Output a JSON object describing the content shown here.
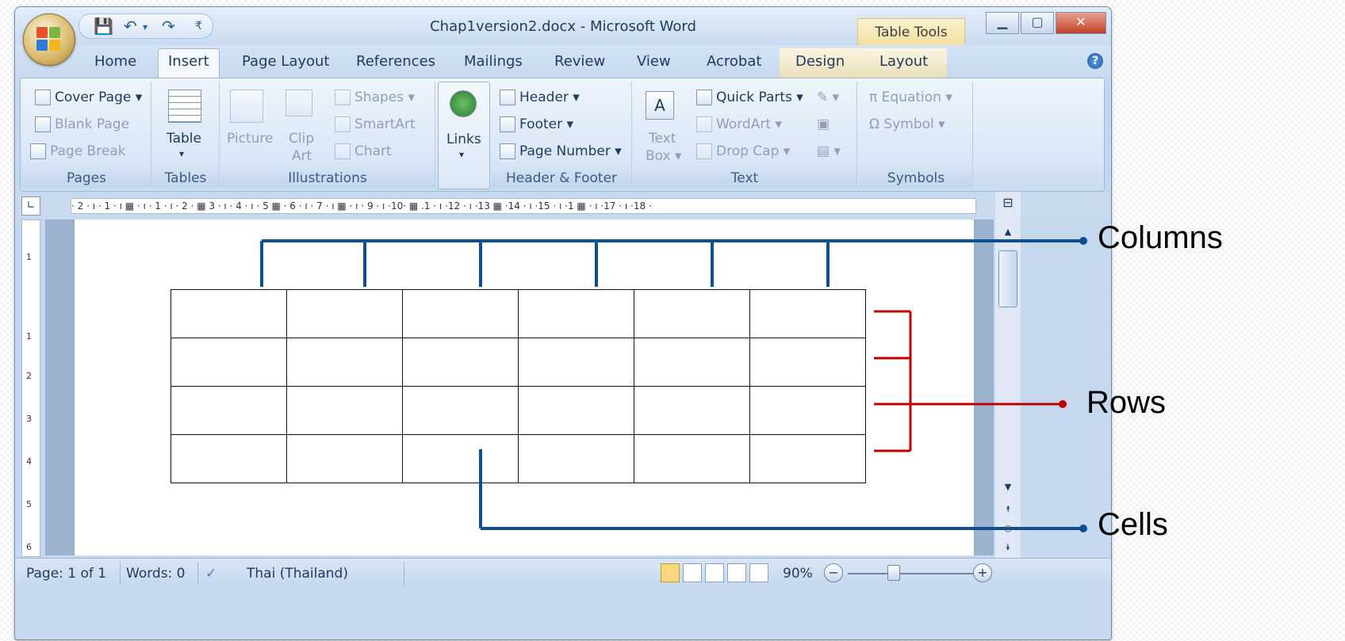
{
  "window": {
    "title": "Chap1version2.docx - Microsoft Word",
    "context_tab_group": "Table Tools"
  },
  "tabs": [
    "Home",
    "Insert",
    "Page Layout",
    "References",
    "Mailings",
    "Review",
    "View",
    "Acrobat",
    "Design",
    "Layout"
  ],
  "active_tab": "Insert",
  "ribbon": {
    "pages": {
      "title": "Pages",
      "items": [
        "Cover Page",
        "Blank Page",
        "Page Break"
      ]
    },
    "tables": {
      "title": "Tables",
      "button": "Table"
    },
    "illustrations": {
      "title": "Illustrations",
      "picture": "Picture",
      "clip_art_line1": "Clip",
      "clip_art_line2": "Art",
      "shapes": "Shapes",
      "smartart": "SmartArt",
      "chart": "Chart"
    },
    "links": {
      "button": "Links"
    },
    "header_footer": {
      "title": "Header & Footer",
      "header": "Header",
      "footer": "Footer",
      "page_number": "Page Number"
    },
    "text": {
      "title": "Text",
      "text_box_line1": "Text",
      "text_box_line2": "Box",
      "quick_parts": "Quick Parts",
      "wordart": "WordArt",
      "drop_cap": "Drop Cap"
    },
    "symbols": {
      "title": "Symbols",
      "equation": "Equation",
      "symbol": "Symbol"
    }
  },
  "ruler_text": "· 2 · ı · 1 · ı ▦ · ı · 1 · ı · 2 · ▦ 3 · ı · 4 · ı · 5 ▦ · 6 · ı · 7 · ı ▦ · ı · 9 · ı ·10· ▦ .1 · ı ·12 · ı ·13 ▦ ·14 · ı ·15 · ı ·1 ▦ · ı ·17 · ı ·18 ·",
  "vertical_ruler": [
    "1",
    "1",
    "2",
    "3",
    "4",
    "5",
    "6"
  ],
  "table": {
    "rows": 4,
    "cols": 6
  },
  "status": {
    "page": "Page: 1 of 1",
    "words": "Words: 0",
    "language": "Thai (Thailand)",
    "zoom": "90%"
  },
  "annotations": {
    "columns": "Columns",
    "rows": "Rows",
    "cells": "Cells",
    "colors": {
      "columns": "#0e4f94",
      "rows": "#c00000",
      "cells": "#0e4f94"
    }
  }
}
